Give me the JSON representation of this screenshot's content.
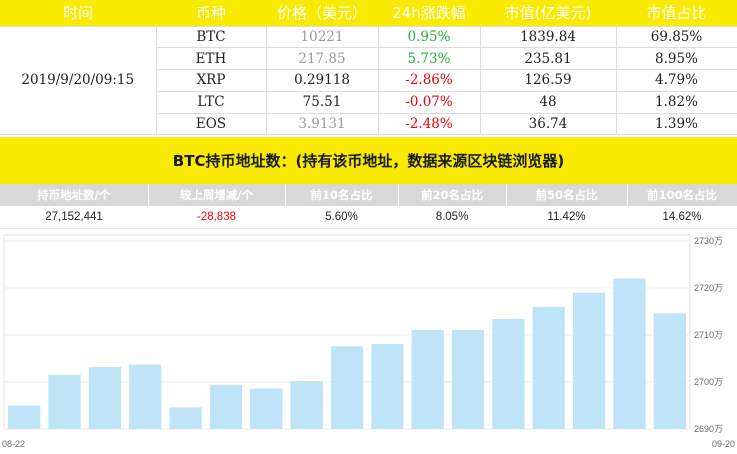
{
  "price_table": {
    "headers": [
      "时间",
      "币种",
      "价格（美元）",
      "24h涨跌幅",
      "市值(亿美元)",
      "市值占比"
    ],
    "time": "2019/9/20/09:15",
    "rows": [
      {
        "coin": "BTC",
        "price": "10221",
        "change": "0.95%",
        "change_dir": "up",
        "market_cap": "1839.84",
        "share": "69.85%",
        "price_tone": "grey"
      },
      {
        "coin": "ETH",
        "price": "217.85",
        "change": "5.73%",
        "change_dir": "up",
        "market_cap": "235.81",
        "share": "8.95%",
        "price_tone": "grey"
      },
      {
        "coin": "XRP",
        "price": "0.29118",
        "change": "-2.86%",
        "change_dir": "down",
        "market_cap": "126.59",
        "share": "4.79%",
        "price_tone": "dark"
      },
      {
        "coin": "LTC",
        "price": "75.51",
        "change": "-0.07%",
        "change_dir": "down",
        "market_cap": "48",
        "share": "1.82%",
        "price_tone": "dark"
      },
      {
        "coin": "EOS",
        "price": "3.9131",
        "change": "-2.48%",
        "change_dir": "down",
        "market_cap": "36.74",
        "share": "1.39%",
        "price_tone": "grey"
      }
    ]
  },
  "banner": {
    "title": "BTC持币地址数：(持有该币地址，数据来源区块链浏览器)"
  },
  "address_table": {
    "headers": [
      "持币地址数/个",
      "较上周增减/个",
      "前10名占比",
      "前20名占比",
      "前50名占比",
      "前100名占比"
    ],
    "values": [
      "27,152,441",
      "-28,838",
      "5.60%",
      "8.05%",
      "11.42%",
      "14.62%"
    ]
  },
  "colors": {
    "yellow": "#f8ea00",
    "up": "#27b135",
    "down": "#e8000b",
    "bar": "#bfe3f7",
    "header_grey": "#d8d8d8"
  },
  "chart_data": {
    "type": "bar",
    "x_start_label": "08-22",
    "x_end_label": "09-20",
    "values": [
      2695.0,
      2701.5,
      2703.2,
      2703.7,
      2694.6,
      2699.4,
      2698.6,
      2700.2,
      2707.6,
      2708.1,
      2711.1,
      2711.1,
      2713.4,
      2716.0,
      2719.0,
      2722.0,
      2714.6
    ],
    "ylim": [
      2690,
      2730
    ],
    "yticks": [
      2690,
      2700,
      2710,
      2720,
      2730
    ],
    "ytick_labels": [
      "2690万",
      "2700万",
      "2710万",
      "2720万",
      "2730万"
    ],
    "grid": true
  }
}
